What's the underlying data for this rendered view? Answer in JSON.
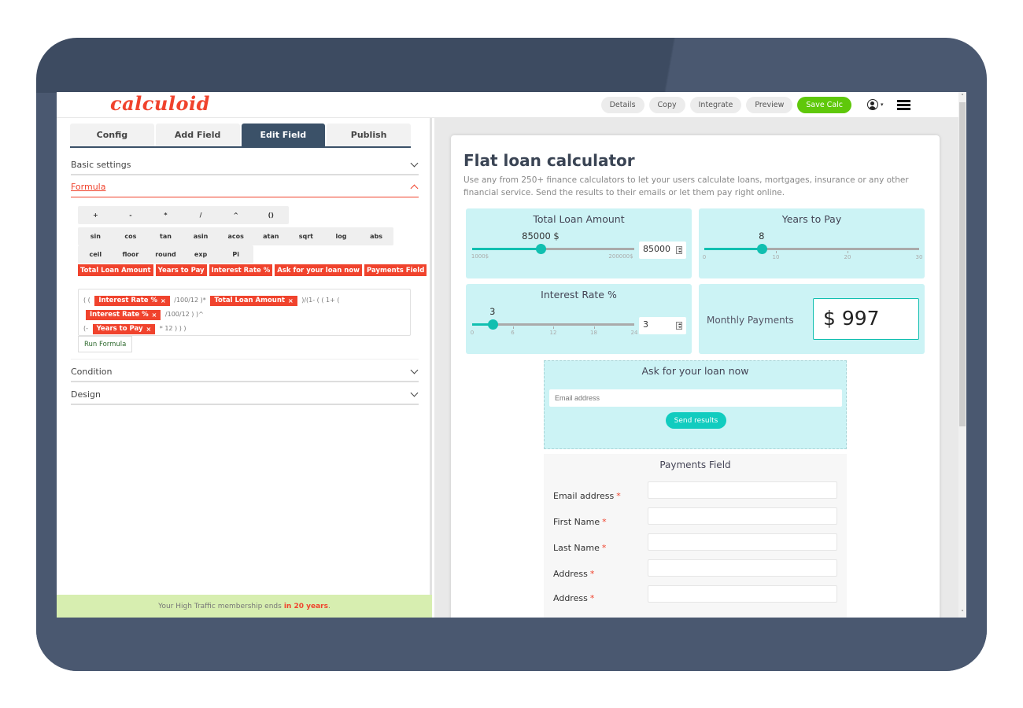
{
  "app": {
    "logo": "calculoid"
  },
  "topbar": {
    "actions": [
      "Details",
      "Copy",
      "Integrate",
      "Preview",
      "Save Calc"
    ],
    "user_caret": "▾"
  },
  "left": {
    "tabs": [
      "Config",
      "Add Field",
      "Edit Field",
      "Publish"
    ],
    "active_tab": "Edit Field",
    "sections": {
      "basic": "Basic settings",
      "formula": "Formula",
      "condition": "Condition",
      "design": "Design"
    },
    "operators": [
      "+",
      "-",
      "*",
      "/",
      "^",
      "()"
    ],
    "functions_row1": [
      "sin",
      "cos",
      "tan",
      "asin",
      "acos",
      "atan",
      "sqrt",
      "log",
      "abs"
    ],
    "functions_row2": [
      "ceil",
      "floor",
      "round",
      "exp",
      "Pi"
    ],
    "field_tags": [
      "Total Loan Amount",
      "Years to Pay",
      "Interest Rate %",
      "Ask for your loan now",
      "Payments Field"
    ],
    "formula": {
      "t1": "( (",
      "chip1": "Interest Rate %",
      "t2": "/100/12 )*",
      "chip2": "Total Loan Amount",
      "t3": ")/(1- ( ( 1+ (",
      "chip3": "Interest Rate %",
      "t4": "/100/12 ) )^",
      "t5": "(-",
      "chip4": "Years to Pay",
      "t6": "* 12 ) ) )",
      "chip_close": "×"
    },
    "run_formula": "Run Formula",
    "membership": {
      "text": "Your High Traffic membership ends",
      "highlight": "in 20 years",
      "suffix": "."
    }
  },
  "calculator": {
    "title": "Flat loan calculator",
    "description": "Use any from 250+ finance calculators to let your users calculate loans, mortgages, insurance or any other financial service. Send the results to their emails or let them pay right online.",
    "total_loan": {
      "label": "Total Loan Amount",
      "value_label": "85000 $",
      "value": 85000,
      "min": 1000,
      "max": 200000,
      "min_label": "1000$",
      "max_label": "200000$",
      "input_value": "85000"
    },
    "years": {
      "label": "Years to Pay",
      "value_label": "8",
      "value": 8,
      "min": 0,
      "max": 30,
      "ticks": [
        "0",
        "10",
        "20",
        "30"
      ]
    },
    "interest": {
      "label": "Interest Rate %",
      "value_label": "3",
      "value": 3,
      "min": 0,
      "max": 24,
      "ticks": [
        "0",
        "6",
        "12",
        "18",
        "24"
      ],
      "input_value": "3"
    },
    "monthly": {
      "label": "Monthly Payments",
      "value": "$ 997"
    },
    "ask": {
      "title": "Ask for your loan now",
      "email_placeholder": "Email address",
      "send": "Send results"
    },
    "payments": {
      "title": "Payments Field",
      "fields": [
        "Email address",
        "First Name",
        "Last Name",
        "Address",
        "Address"
      ],
      "required_mark": "*"
    }
  },
  "scrollbar": {
    "up": "˄",
    "down": "˅"
  }
}
